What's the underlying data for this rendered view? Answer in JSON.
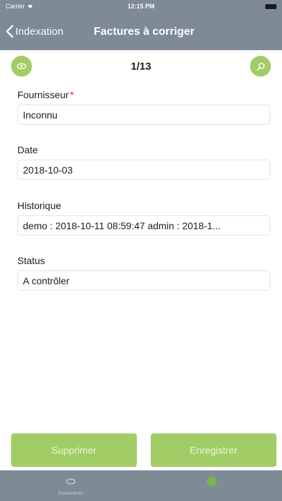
{
  "status_bar": {
    "carrier": "Carrier",
    "time": "12:15 PM"
  },
  "nav": {
    "back_label": "Indexation",
    "title": "Factures à corriger"
  },
  "toolbar": {
    "pager": "1/13"
  },
  "form": {
    "fields": [
      {
        "label": "Fournisseur",
        "required_mark": "*",
        "value": "Inconnu"
      },
      {
        "label": "Date",
        "value": "2018-10-03"
      },
      {
        "label": "Historique",
        "value": "demo : 2018-10-11 08:59:47 admin : 2018-1..."
      },
      {
        "label": "Status",
        "value": "A contrôler"
      }
    ]
  },
  "actions": {
    "delete_label": "Supprimer",
    "save_label": "Enregistrer"
  },
  "tabs": [
    {
      "label": "Documents",
      "icon": "eye-icon"
    },
    {
      "label": "",
      "icon": "dot-icon"
    }
  ],
  "colors": {
    "header": "#7f8a97",
    "accent": "#a2cd66",
    "required": "#e02020"
  }
}
